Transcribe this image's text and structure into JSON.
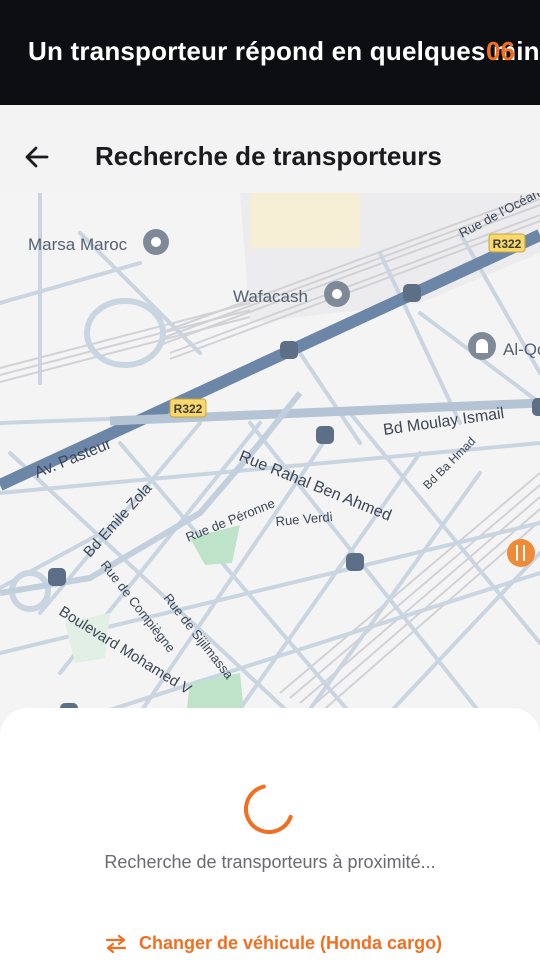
{
  "banner": {
    "text": "Un transporteur répond en quelques minutes",
    "count": "06"
  },
  "header": {
    "title": "Recherche de transporteurs",
    "back_icon": "arrow-left-icon"
  },
  "map": {
    "pois": {
      "marsa": "Marsa Maroc",
      "wafacash": "Wafacash",
      "alq": "Al-Qods"
    },
    "road_badges": {
      "r322_top": "R322",
      "r322_mid": "R322"
    },
    "streets": {
      "rue_ocean": "Rue de l'Océan",
      "av_pasteur": "Av. Pasteur",
      "bd_moulay": "Bd Moulay Ismail",
      "bd_ba_hmad": "Bd Ba Hmad",
      "rue_rahal": "Rue Rahal Ben Ahmed",
      "bd_emile": "Bd Emile Zola",
      "rue_peronne": "Rue de Péronne",
      "rue_verdi": "Rue Verdi",
      "rue_compiegne": "Rue de Compiègne",
      "rue_sijilmassa": "Rue de Sijilmassa",
      "bd_mohamed": "Boulevard Mohamed V"
    }
  },
  "sheet": {
    "status": "Recherche de transporteurs à proximité...",
    "change_label": "Changer de véhicule (Honda cargo)",
    "change_icon": "swap-arrows-icon"
  },
  "colors": {
    "accent": "#f26f21",
    "banner_bg": "#0d0e12",
    "map_bg": "#f4f4f5",
    "major_road": "#6c86a8",
    "road": "#c9d5e1"
  }
}
